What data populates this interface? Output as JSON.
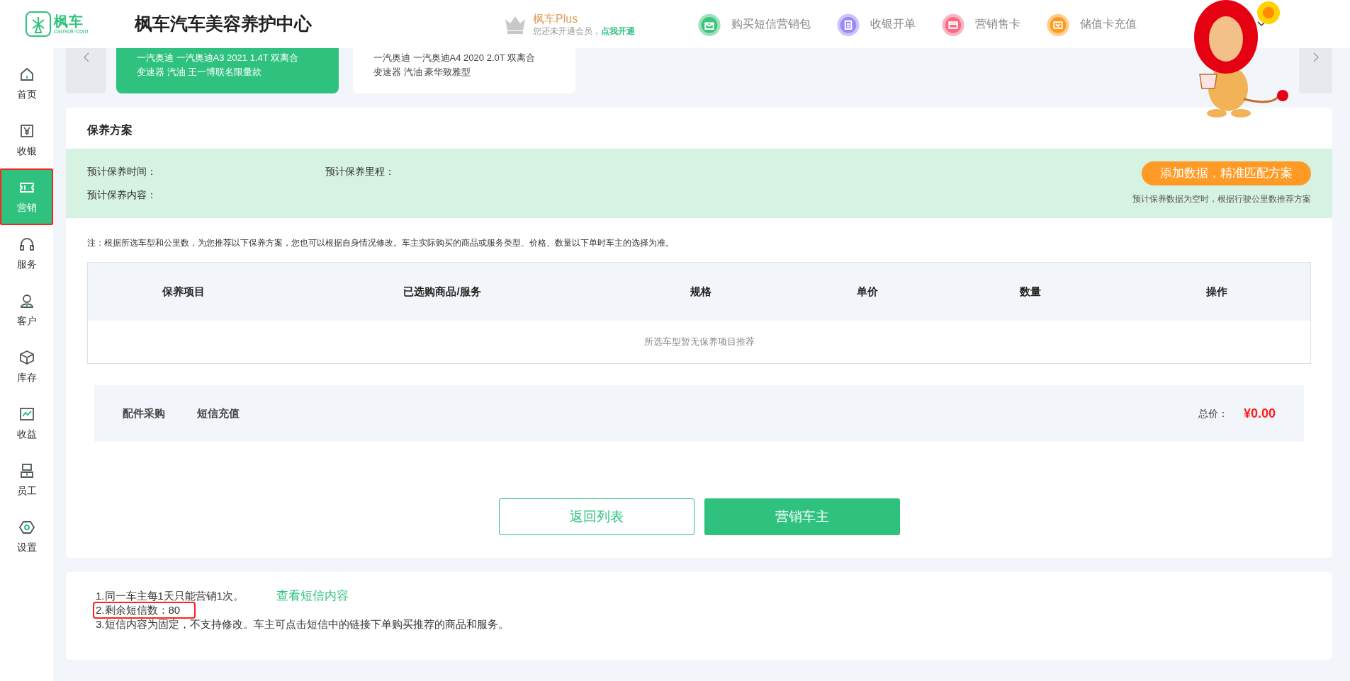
{
  "header": {
    "logo_text": "枫车",
    "logo_subtext": "carisok·com",
    "title": "枫车汽车美容养护中心",
    "plus": {
      "title": "枫车Plus",
      "text": "您还未开通会员，",
      "link": "点我开通"
    },
    "actions": [
      {
        "label": "购买短信营销包",
        "color": "#3cc47c"
      },
      {
        "label": "收银开单",
        "color": "#9b87f5"
      },
      {
        "label": "营销售卡",
        "color": "#f76b84"
      },
      {
        "label": "储值卡充值",
        "color": "#ff9a1a"
      }
    ]
  },
  "sidebar": {
    "items": [
      {
        "label": "首页",
        "selected": false,
        "highlighted": false
      },
      {
        "label": "收银",
        "selected": false,
        "highlighted": false
      },
      {
        "label": "营销",
        "selected": true,
        "highlighted": true
      },
      {
        "label": "服务",
        "selected": false,
        "highlighted": false
      },
      {
        "label": "客户",
        "selected": false,
        "highlighted": false
      },
      {
        "label": "库存",
        "selected": false,
        "highlighted": false
      },
      {
        "label": "收益",
        "selected": false,
        "highlighted": false
      },
      {
        "label": "员工",
        "selected": false,
        "highlighted": false
      },
      {
        "label": "设置",
        "selected": false,
        "highlighted": false
      }
    ]
  },
  "car_cards": [
    {
      "lines": [
        "一汽奥迪 一汽奥迪A3 2021 1.4T 双离合",
        "变速器 汽油 王一博联名限量款"
      ],
      "selected": true
    },
    {
      "lines": [
        "一汽奥迪 一汽奥迪A4 2020 2.0T 双离合",
        "变速器 汽油 豪华致雅型"
      ],
      "selected": false
    }
  ],
  "plan": {
    "title": "保养方案",
    "fields": [
      "预计保养时间：",
      "预计保养里程：",
      "预计保养内容："
    ],
    "match_button": "添加数据，精准匹配方案",
    "match_hint": "预计保养数据为空时，根据行驶公里数推荐方案",
    "note": "注：根据所选车型和公里数，为您推荐以下保养方案，您也可以根据自身情况修改。车主实际购买的商品或服务类型、价格、数量以下单时车主的选择为准。",
    "table": {
      "columns": [
        "保养项目",
        "已选购商品/服务",
        "规格",
        "单价",
        "数量",
        "操作"
      ],
      "empty_text": "所选车型暂无保养项目推荐"
    },
    "links": [
      "配件采购",
      "短信充值"
    ],
    "total_label": "总价：",
    "total_value": "¥0.00",
    "buttons": {
      "back": "返回列表",
      "submit": "营销车主"
    }
  },
  "notes": {
    "items": [
      {
        "text": "1.同一车主每1天只能营销1次。",
        "highlighted": false,
        "link": "查看短信内容"
      },
      {
        "text": "2.剩余短信数：80",
        "highlighted": true
      },
      {
        "text": "3.短信内容为固定，不支持修改。车主可点击短信中的链接下单购买推荐的商品和服务。",
        "highlighted": false
      }
    ]
  }
}
